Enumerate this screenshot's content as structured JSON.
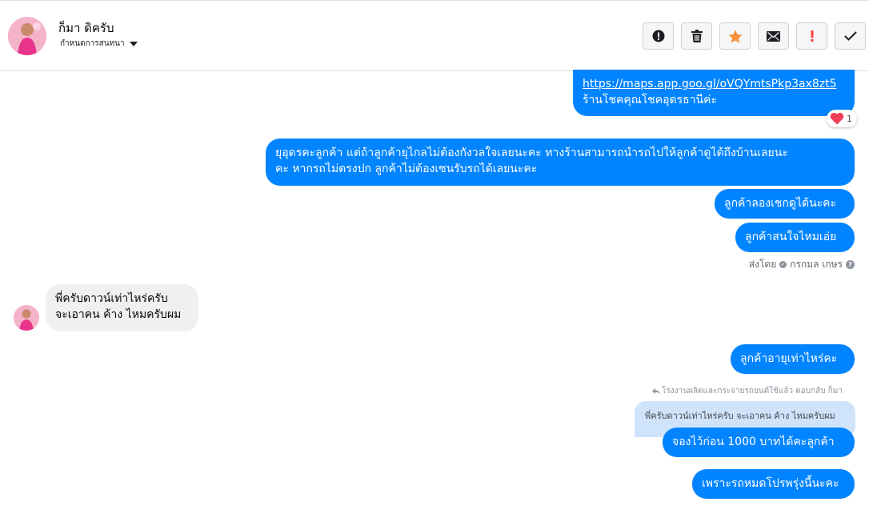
{
  "header": {
    "contact_name": "ก็มา ดิครับ",
    "settings_label": "กำหนดการสนทนา",
    "actions": [
      {
        "name": "report",
        "icon": "exclamation-circle-icon"
      },
      {
        "name": "delete",
        "icon": "trash-icon"
      },
      {
        "name": "star",
        "icon": "star-icon"
      },
      {
        "name": "mark-unread",
        "icon": "envelope-icon"
      },
      {
        "name": "important",
        "icon": "exclamation-icon"
      },
      {
        "name": "done",
        "icon": "check-icon"
      }
    ]
  },
  "messages": {
    "m1_link": "https://maps.app.goo.gl/oVQYmtsPkp3ax8zt5",
    "m1_text": "ร้านโชคคุณโชคอุดรธานีค่ะ",
    "m1_reaction_count": "1",
    "m2_line1": "ยุอุดรคะลูกค้า แต่ถ้าลูกค้ายุไกลไม่ต้องกังวลใจเลยนะคะ ทางร้านสามารถนำรถไปให้ลูกค้าดูได้ถึงบ้านเลยนะ",
    "m2_line2": "คะ หากรถไม่ตรงปก ลูกค้าไม่ต้องเซนรับรถได้เลยนะคะ",
    "m3": "ลูกค้าลองเชกดูได้นะคะ",
    "m4": "ลูกค้าสนใจไหมเอ่ย",
    "sent_by_label": "ส่งโดย",
    "sent_by_name": "กรกมล เกษร",
    "in1_line1": "พี่ครับดาวน์เท่าไหร่ครับ",
    "in1_line2": "จะเอาคน ค้าง ไหมครับผม",
    "m5": "ลูกค้าอายุเท่าไหร่คะ",
    "reply_note": "โรงงานผลิตและกระจายรถยนต์ใช้แล้ว ตอบกลับ ก็มา",
    "quoted": "พี่ครับดาวน์เท่าไหร่ครับ จะเอาคน ค้าง ไหมครับผม",
    "m6": "จองไว้ก่อน 1000 บาทได้คะลูกค้า",
    "m7": "เพราะรถหมดโปรพรุ่งนี้นะคะ"
  },
  "colors": {
    "outgoing": "#0084ff",
    "incoming": "#f1f0f0",
    "star": "#f7923a",
    "important": "#fa3e3e"
  }
}
